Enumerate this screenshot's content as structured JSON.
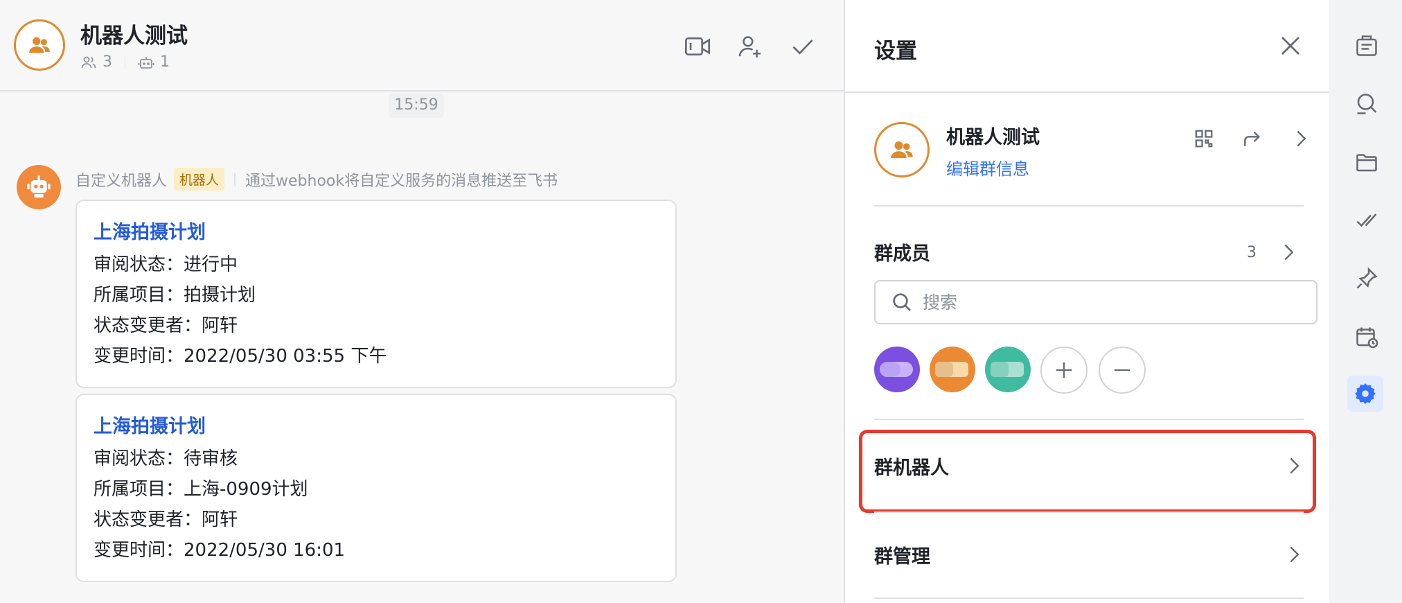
{
  "chat": {
    "title": "机器人测试",
    "member_count": "3",
    "bot_count": "1",
    "timestamp": "15:59",
    "message": {
      "sender": "自定义机器人",
      "tag": "机器人",
      "description": "通过webhook将自定义服务的消息推送至飞书",
      "cards": [
        {
          "title": "上海拍摄计划",
          "rows": [
            "审阅状态：进行中",
            "所属项目：拍摄计划",
            "状态变更者：阿轩",
            "变更时间：2022/05/30 03:55 下午"
          ]
        },
        {
          "title": "上海拍摄计划",
          "rows": [
            "审阅状态：待审核",
            "所属项目：上海-0909计划",
            "状态变更者：阿轩",
            "变更时间：2022/05/30 16:01"
          ]
        }
      ]
    }
  },
  "settings": {
    "title": "设置",
    "group_name": "机器人测试",
    "edit_info": "编辑群信息",
    "members_label": "群成员",
    "members_count": "3",
    "search_placeholder": "搜索",
    "rows": [
      "群机器人",
      "群管理"
    ]
  },
  "colors": {
    "accent": "#3370ff",
    "avatar_orange": "#e08a2c",
    "highlight_red": "#e8392d"
  },
  "icons": {
    "header": [
      "video-call-icon",
      "add-member-icon",
      "check-icon"
    ],
    "rail": [
      "announcement-icon",
      "search-icon",
      "folder-icon",
      "tasks-icon",
      "pin-icon",
      "calendar-icon",
      "settings-icon"
    ]
  }
}
